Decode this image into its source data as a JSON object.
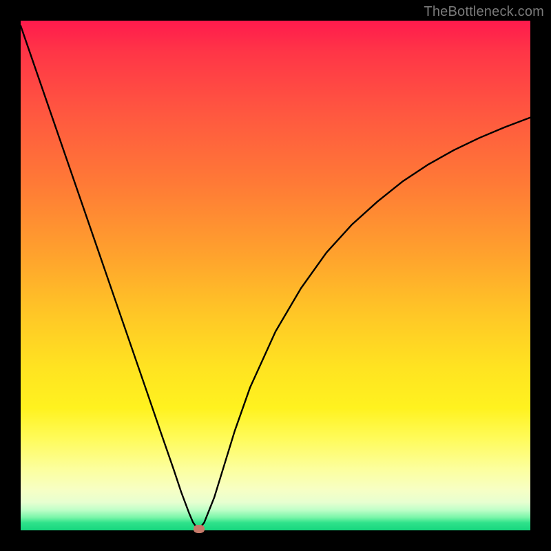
{
  "watermark": "TheBottleneck.com",
  "chart_data": {
    "type": "line",
    "title": "",
    "xlabel": "",
    "ylabel": "",
    "xlim": [
      0,
      100
    ],
    "ylim": [
      0,
      100
    ],
    "x": [
      0,
      5,
      10,
      15,
      20,
      25,
      27.5,
      30,
      31.5,
      33,
      33.8,
      34.5,
      35,
      36,
      38,
      40,
      42,
      45,
      50,
      55,
      60,
      65,
      70,
      75,
      80,
      85,
      90,
      95,
      100
    ],
    "values": [
      99,
      84.5,
      70,
      55.5,
      41,
      26.5,
      19.2,
      12,
      7.5,
      3.5,
      1.6,
      0.6,
      0.3,
      1.5,
      6.5,
      13,
      19.5,
      28,
      39,
      47.5,
      54.5,
      60,
      64.5,
      68.5,
      71.8,
      74.6,
      77,
      79.1,
      81
    ],
    "marker": {
      "x": 35,
      "y": 0.3
    },
    "grid": false,
    "legend": false
  },
  "colors": {
    "curve": "#000000",
    "marker": "#c77a6a",
    "frame": "#000000"
  }
}
